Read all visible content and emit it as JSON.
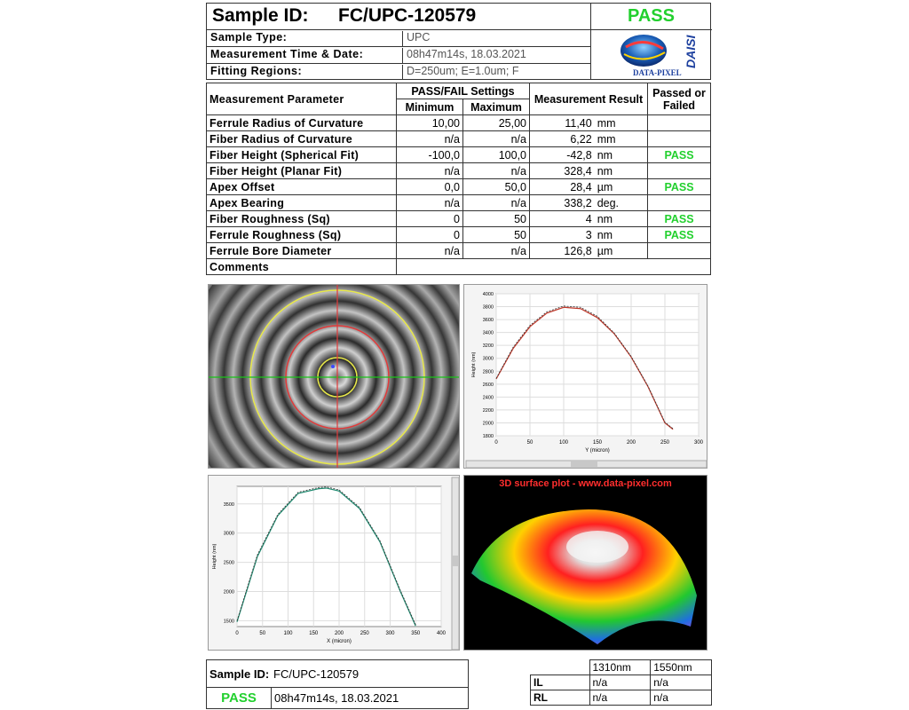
{
  "header": {
    "sample_id_label": "Sample ID:",
    "sample_id": "FC/UPC-120579",
    "status": "PASS",
    "rows": [
      {
        "label": "Sample Type:",
        "value": "UPC"
      },
      {
        "label": "Measurement Time & Date:",
        "value": "08h47m14s, 18.03.2021"
      },
      {
        "label": "Fitting Regions:",
        "value": "D=250um; E=1.0um; F"
      }
    ],
    "logo_text": "DATA-PIXEL",
    "logo_side": "DAISI"
  },
  "table": {
    "h_param": "Measurement Parameter",
    "h_settings": "PASS/FAIL Settings",
    "h_min": "Minimum",
    "h_max": "Maximum",
    "h_result": "Measurement Result",
    "h_passed": "Passed or Failed",
    "rows": [
      {
        "name": "Ferrule Radius of Curvature",
        "min": "10,00",
        "max": "25,00",
        "result": "11,40",
        "unit": "mm",
        "pf": ""
      },
      {
        "name": "Fiber Radius of Curvature",
        "min": "n/a",
        "max": "n/a",
        "result": "6,22",
        "unit": "mm",
        "pf": ""
      },
      {
        "name": "Fiber Height (Spherical Fit)",
        "min": "-100,0",
        "max": "100,0",
        "result": "-42,8",
        "unit": "nm",
        "pf": "PASS"
      },
      {
        "name": "Fiber Height (Planar Fit)",
        "min": "n/a",
        "max": "n/a",
        "result": "328,4",
        "unit": "nm",
        "pf": ""
      },
      {
        "name": "Apex Offset",
        "min": "0,0",
        "max": "50,0",
        "result": "28,4",
        "unit": "µm",
        "pf": "PASS"
      },
      {
        "name": "Apex Bearing",
        "min": "n/a",
        "max": "n/a",
        "result": "338,2",
        "unit": "deg.",
        "pf": ""
      },
      {
        "name": "Fiber Roughness (Sq)",
        "min": "0",
        "max": "50",
        "result": "4",
        "unit": "nm",
        "pf": "PASS"
      },
      {
        "name": "Ferrule Roughness (Sq)",
        "min": "0",
        "max": "50",
        "result": "3",
        "unit": "nm",
        "pf": "PASS"
      },
      {
        "name": "Ferrule Bore Diameter",
        "min": "n/a",
        "max": "n/a",
        "result": "126,8",
        "unit": "µm",
        "pf": ""
      }
    ],
    "comments_label": "Comments"
  },
  "surface_title": "3D surface plot - www.data-pixel.com",
  "chart_data": [
    {
      "type": "line",
      "xlabel": "Y (micron)",
      "ylabel": "Height (nm)",
      "xlim": [
        0,
        300
      ],
      "ylim": [
        1800,
        4000
      ],
      "xticks": [
        0,
        50,
        100,
        150,
        200,
        250,
        300
      ],
      "yticks": [
        1800,
        2000,
        2200,
        2400,
        2600,
        2800,
        3000,
        3200,
        3400,
        3600,
        3800,
        4000
      ],
      "series": [
        {
          "color": "#c0392b",
          "x": [
            0,
            25,
            50,
            75,
            100,
            125,
            150,
            175,
            200,
            225,
            250,
            262
          ],
          "y": [
            2680,
            3150,
            3490,
            3700,
            3790,
            3770,
            3630,
            3380,
            3020,
            2560,
            2000,
            1900
          ]
        },
        {
          "color": "#333333",
          "x": [
            0,
            25,
            50,
            75,
            100,
            125,
            150,
            175,
            200,
            225,
            250,
            262
          ],
          "y": [
            2690,
            3170,
            3510,
            3720,
            3810,
            3790,
            3650,
            3390,
            3030,
            2570,
            2010,
            1910
          ]
        }
      ]
    },
    {
      "type": "line",
      "xlabel": "X (micron)",
      "ylabel": "Height (nm)",
      "xlim": [
        0,
        400
      ],
      "ylim": [
        1400,
        3800
      ],
      "xticks": [
        0,
        50,
        100,
        150,
        200,
        250,
        300,
        350,
        400
      ],
      "yticks": [
        1500,
        2000,
        2500,
        3000,
        3500
      ],
      "series": [
        {
          "color": "#1f8a70",
          "x": [
            0,
            40,
            80,
            120,
            160,
            175,
            200,
            240,
            280,
            320,
            350
          ],
          "y": [
            1480,
            2600,
            3300,
            3680,
            3760,
            3770,
            3720,
            3420,
            2850,
            2000,
            1410
          ]
        },
        {
          "color": "#333333",
          "x": [
            0,
            40,
            80,
            120,
            160,
            175,
            200,
            240,
            280,
            320,
            350
          ],
          "y": [
            1500,
            2630,
            3320,
            3700,
            3780,
            3790,
            3740,
            3440,
            2870,
            2020,
            1430
          ]
        }
      ]
    }
  ],
  "footer": {
    "sid_label": "Sample ID:",
    "sid_value": "FC/UPC-120579",
    "status": "PASS",
    "datetime": "08h47m14s, 18.03.2021",
    "loss": {
      "cols": [
        "1310nm",
        "1550nm"
      ],
      "rows": [
        {
          "label": "IL",
          "v": [
            "n/a",
            "n/a"
          ]
        },
        {
          "label": "RL",
          "v": [
            "n/a",
            "n/a"
          ]
        }
      ]
    }
  }
}
